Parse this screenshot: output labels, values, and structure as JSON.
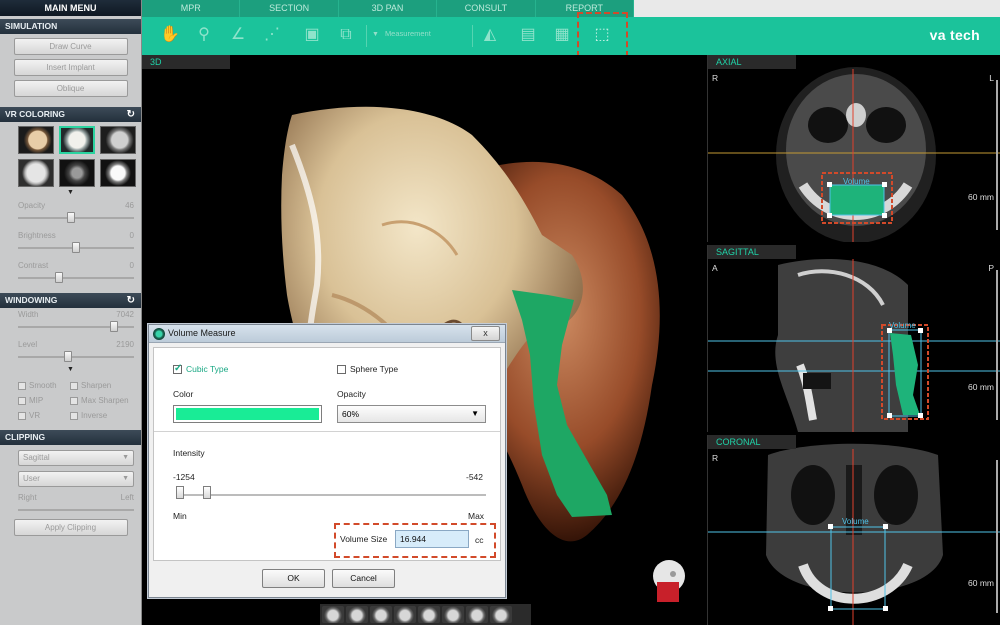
{
  "top_tabs": [
    "MPR",
    "SECTION",
    "3D PAN",
    "CONSULT",
    "REPORT"
  ],
  "brand": "va tech",
  "toolbar": {
    "measurement_label": "Measurement"
  },
  "left_panel": {
    "title": "MAIN MENU",
    "simulation": {
      "header": "SIMULATION",
      "buttons": [
        "Draw Curve",
        "Insert Implant",
        "Oblique"
      ]
    },
    "vr_coloring": {
      "header": "VR COLORING",
      "opacity": {
        "label": "Opacity",
        "value": "46",
        "level": 0.46
      },
      "brightness": {
        "label": "Brightness",
        "value": "0",
        "level": 0.5
      },
      "contrast": {
        "label": "Contrast",
        "value": "0",
        "level": 0.35
      }
    },
    "windowing": {
      "header": "WINDOWING",
      "width": {
        "label": "Width",
        "value": "7042",
        "level": 0.83
      },
      "level": {
        "label": "Level",
        "value": "2190",
        "level": 0.43
      },
      "checks": [
        "Smooth",
        "Sharpen",
        "MIP",
        "Max Sharpen",
        "VR",
        "Inverse"
      ]
    },
    "clipping": {
      "header": "CLIPPING",
      "plane": "Sagittal",
      "mode": "User",
      "right": "Right",
      "left": "Left",
      "apply": "Apply Clipping"
    }
  },
  "view_3d": {
    "label": "3D"
  },
  "dialog": {
    "title": "Volume Measure",
    "close": "x",
    "cubic": "Cubic Type",
    "sphere": "Sphere Type",
    "color_label": "Color",
    "color": "#19ec96",
    "opacity_label": "Opacity",
    "opacity_value": "60%",
    "intensity_label": "Intensity",
    "intensity_min_value": "-1254",
    "intensity_max_value": "-542",
    "min_label": "Min",
    "max_label": "Max",
    "volume_label": "Volume Size",
    "volume_value": "16.944",
    "volume_unit": "cc",
    "ok": "OK",
    "cancel": "Cancel"
  },
  "axial": {
    "label": "AXIAL",
    "left": "R",
    "right": "L",
    "scale": "60 mm",
    "roi": "Volume"
  },
  "sagittal": {
    "label": "SAGITTAL",
    "left": "A",
    "right": "P",
    "scale": "60 mm",
    "roi": "Volume"
  },
  "coronal": {
    "label": "CORONAL",
    "left": "R",
    "scale": "60 mm",
    "roi": "Volume"
  }
}
